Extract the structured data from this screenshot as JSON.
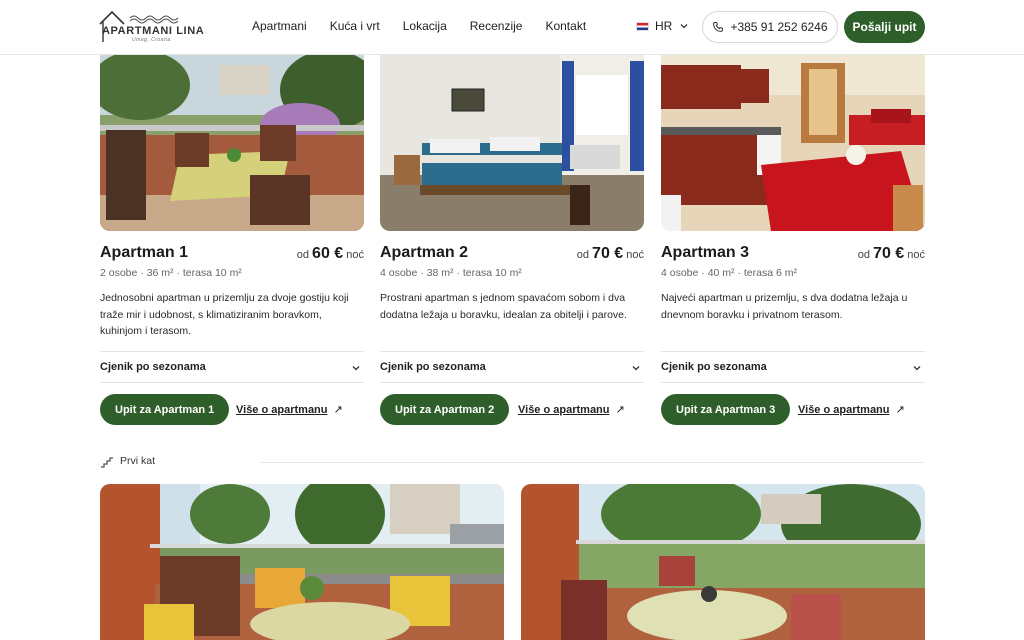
{
  "header": {
    "logo_name": "APARTMANI LINA",
    "logo_sub": "Umag, Croatia",
    "nav": [
      "Apartmani",
      "Kuća i vrt",
      "Lokacija",
      "Recenzije",
      "Kontakt"
    ],
    "lang": "HR",
    "phone": "+385 91 252 6246",
    "send_label": "Pošalji upit"
  },
  "cards": [
    {
      "title": "Apartman 1",
      "price_prefix": "od",
      "price": "60 €",
      "price_suffix": "noć",
      "specs": "2 osobe  ·  36 m²  ·  terasa 10 m²",
      "desc": "Jednosobni apartman u prizemlju za dvoje gostiju koji traže mir i udobnost, s klimatiziranim boravkom, kuhinjom i terasom.",
      "season": "Cjenik po sezonama",
      "inquiry": "Upit za Apartman 1",
      "more": "Više o apartmanu"
    },
    {
      "title": "Apartman 2",
      "price_prefix": "od",
      "price": "70 €",
      "price_suffix": "noć",
      "specs": "4 osobe  ·  38 m²  ·  terasa 10 m²",
      "desc": "Prostrani apartman s jednom spavaćom sobom i dva dodatna ležaja u boravku, idealan za obitelji i parove.",
      "season": "Cjenik po sezonama",
      "inquiry": "Upit za Apartman 2",
      "more": "Više o apartmanu"
    },
    {
      "title": "Apartman 3",
      "price_prefix": "od",
      "price": "70 €",
      "price_suffix": "noć",
      "specs": "4 osobe  ·  40 m²  ·  terasa 6 m²",
      "desc": "Najveći apartman u prizemlju, s dva dodatna ležaja u dnevnom boravku i privatnom terasom.",
      "season": "Cjenik po sezonama",
      "inquiry": "Upit za Apartman 3",
      "more": "Više o apartmanu"
    }
  ],
  "floor_label": "Prvi kat",
  "colors": {
    "accent": "#2e5f2b",
    "text": "#1c1c1c",
    "muted": "#666666"
  }
}
